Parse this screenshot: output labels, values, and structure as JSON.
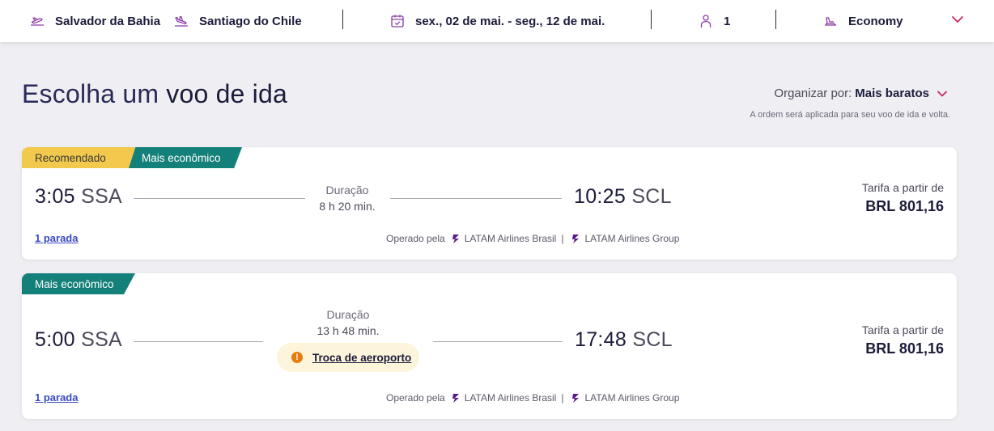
{
  "search": {
    "origin": "Salvador da Bahia",
    "destination": "Santiago do Chile",
    "dates": "sex., 02 de mai. - seg., 12 de mai.",
    "passengers": "1",
    "cabin": "Economy",
    "icons": [
      "takeoff-icon",
      "landing-icon",
      "calendar-icon",
      "person-icon",
      "seat-icon",
      "chevron-down-icon"
    ]
  },
  "heading": {
    "title_prefix": "Escolha um",
    "title_strong": "voo de ida",
    "sort_label": "Organizar por:",
    "sort_value": "Mais baratos",
    "sort_note": "A ordem será aplicada para seu voo de ida e volta."
  },
  "colors": {
    "brand": "#1b0088",
    "recommended_badge": "#f2c94c",
    "economic_badge": "#14807a",
    "warning": "#e87d0d",
    "link": "#3b4cc0"
  },
  "flights": [
    {
      "badges": [
        "Recomendado",
        "Mais econômico"
      ],
      "departure_time": "3:05",
      "departure_code": "SSA",
      "duration_label": "Duração",
      "duration": "8 h 20 min.",
      "arrival_time": "10:25",
      "arrival_code": "SCL",
      "stops": "1 parada",
      "operated_by": "Operado pela",
      "airlines": [
        "LATAM Airlines Brasil",
        "LATAM Airlines Group"
      ],
      "price_label": "Tarifa a partir de",
      "price": "BRL 801,16"
    },
    {
      "badges": [
        "Mais econômico"
      ],
      "departure_time": "5:00",
      "departure_code": "SSA",
      "duration_label": "Duração",
      "duration": "13 h 48 min.",
      "airport_change": "Troca de aeroporto",
      "arrival_time": "17:48",
      "arrival_code": "SCL",
      "stops": "1 parada",
      "operated_by": "Operado pela",
      "airlines": [
        "LATAM Airlines Brasil",
        "LATAM Airlines Group"
      ],
      "price_label": "Tarifa a partir de",
      "price": "BRL 801,16"
    }
  ]
}
